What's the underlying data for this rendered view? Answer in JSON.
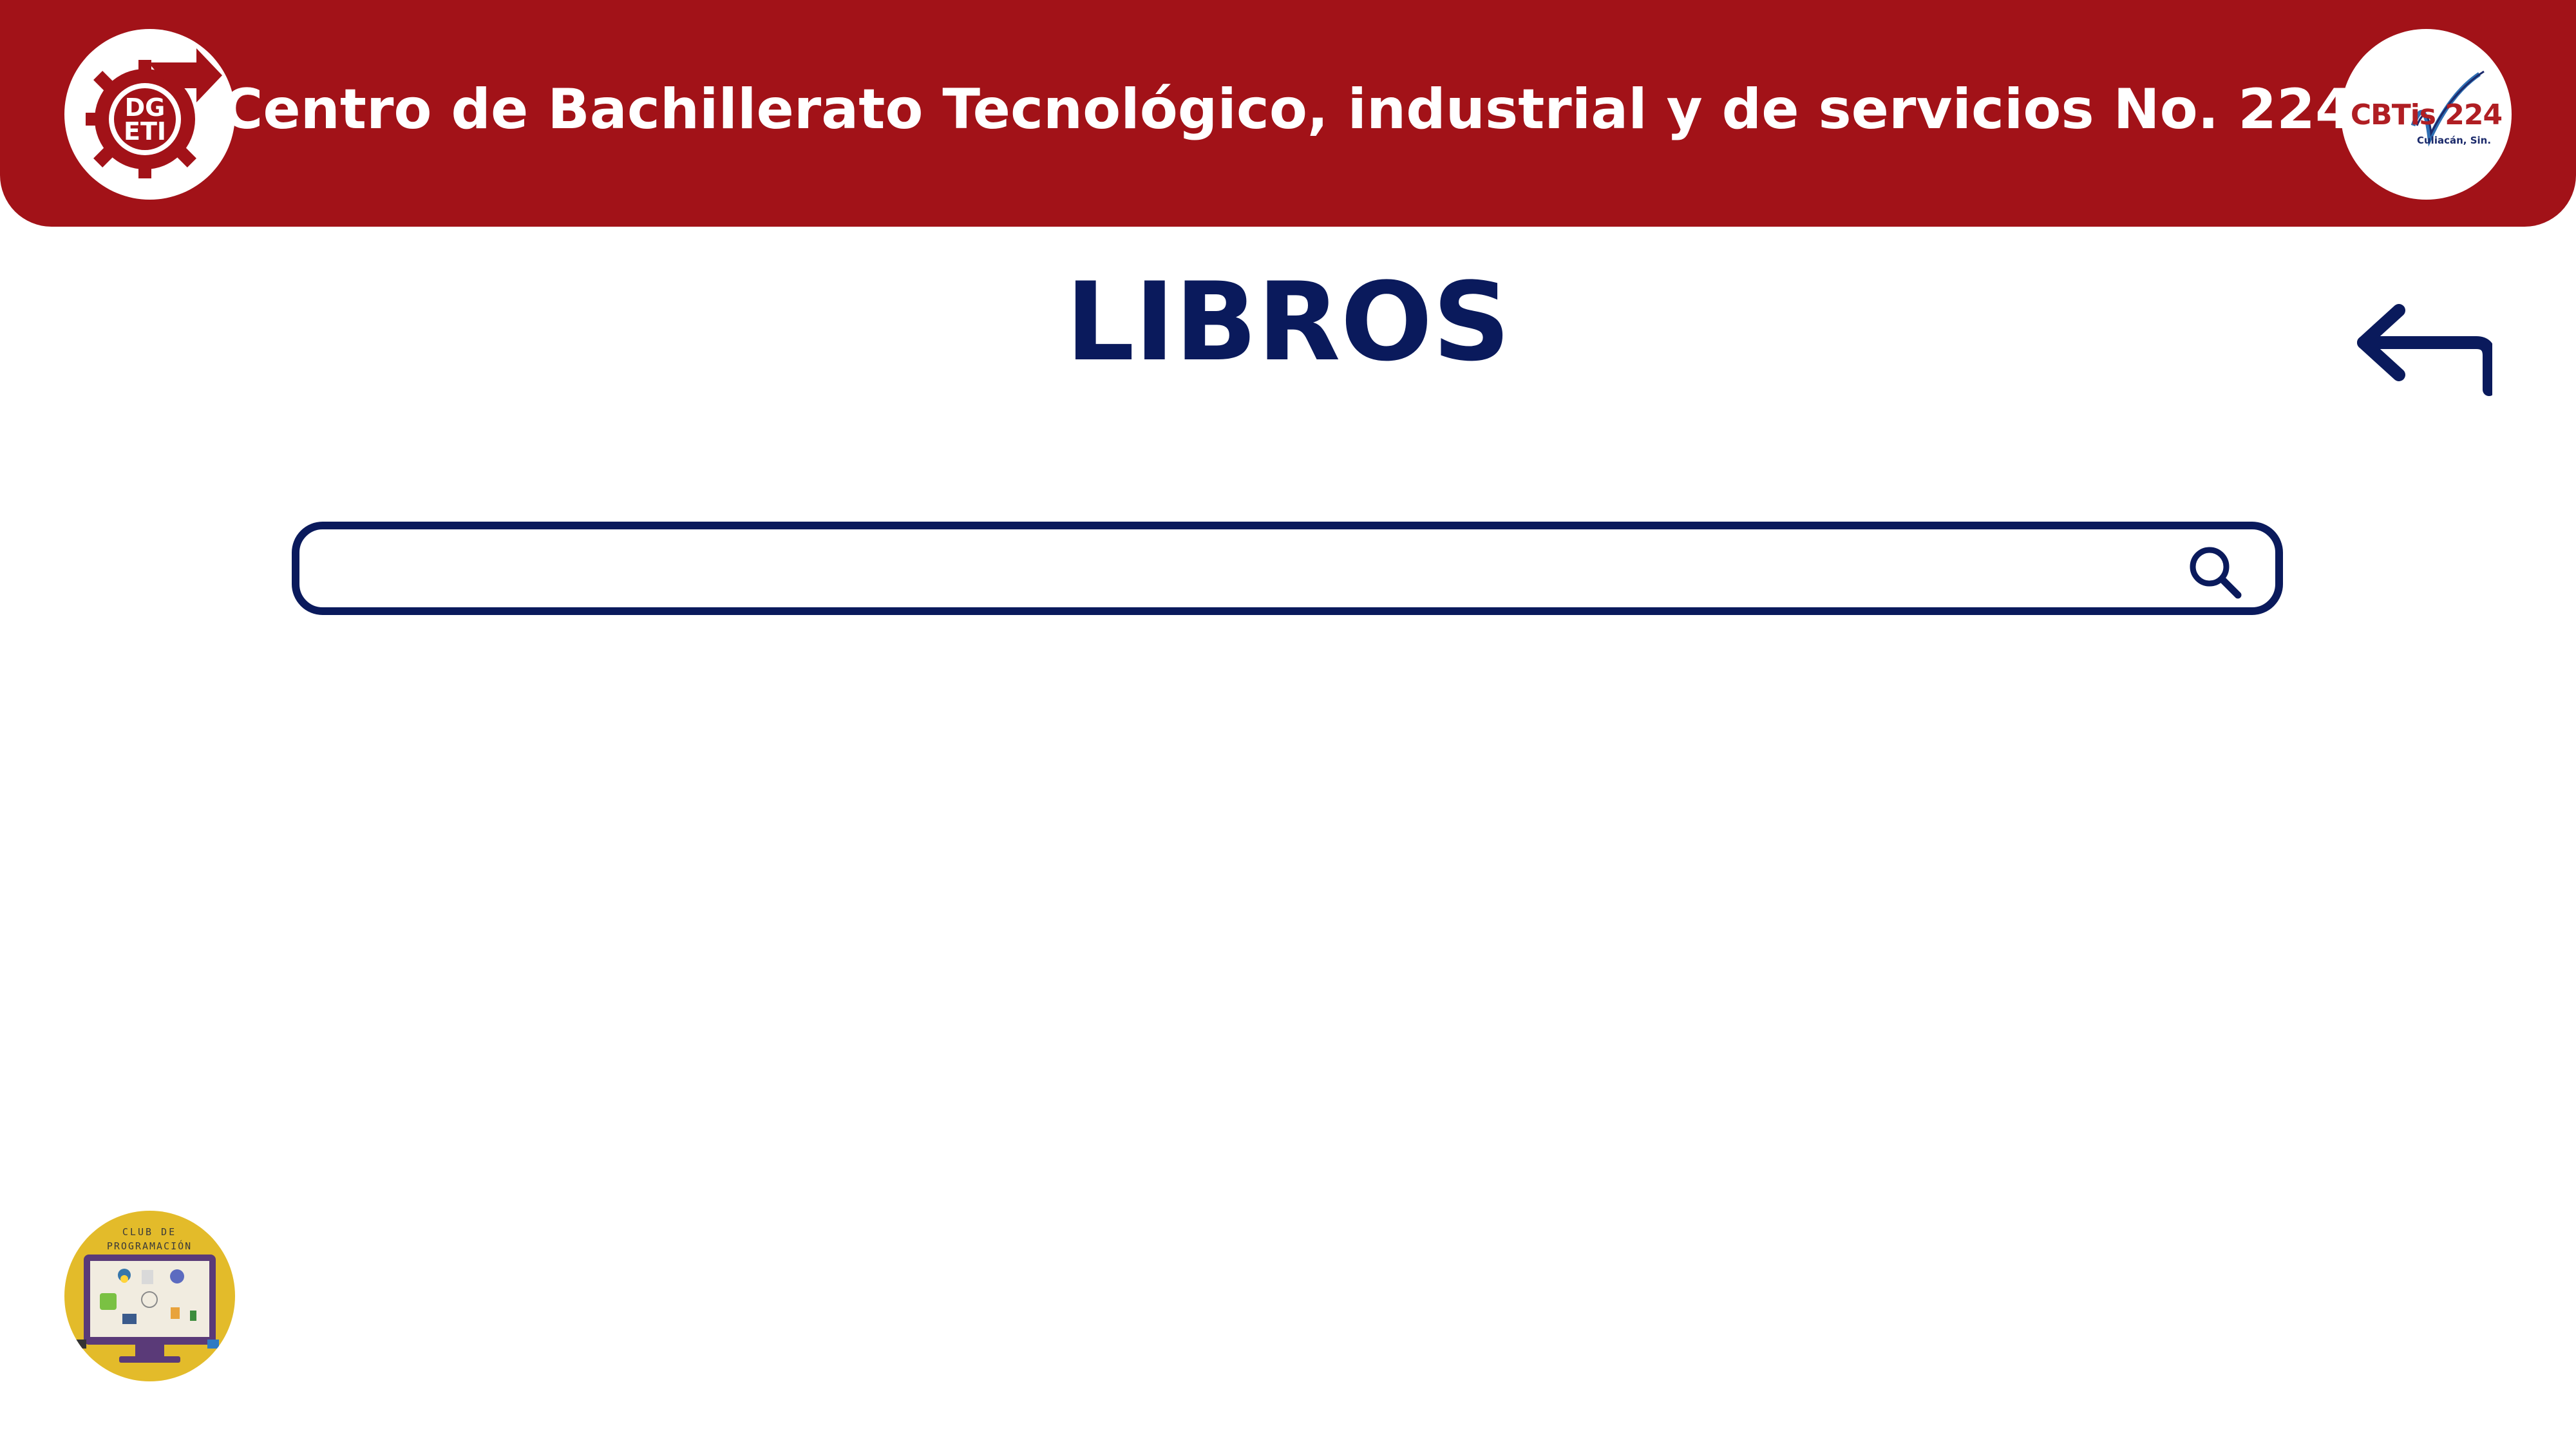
{
  "header": {
    "title": "Centro de Bachillerato Tecnológico, industrial y de servicios No. 224",
    "left_logo": {
      "name": "dgeti-logo",
      "text": "DGETI"
    },
    "right_logo": {
      "name": "cbtis-224-logo",
      "text": "CBTis 224",
      "subtext": "Culiacán, Sin."
    }
  },
  "main": {
    "title": "LIBROS",
    "back_icon": "return-arrow-icon",
    "search": {
      "placeholder": "",
      "value": "",
      "icon": "search-icon"
    }
  },
  "footer": {
    "club_logo": {
      "name": "club-de-programacion-logo",
      "text": "CLUB DE PROGRAMACIÓN"
    }
  },
  "colors": {
    "header_bg": "#a21218",
    "navy": "#0a1a5c",
    "club_yellow": "#e3bb2a",
    "white": "#ffffff"
  }
}
